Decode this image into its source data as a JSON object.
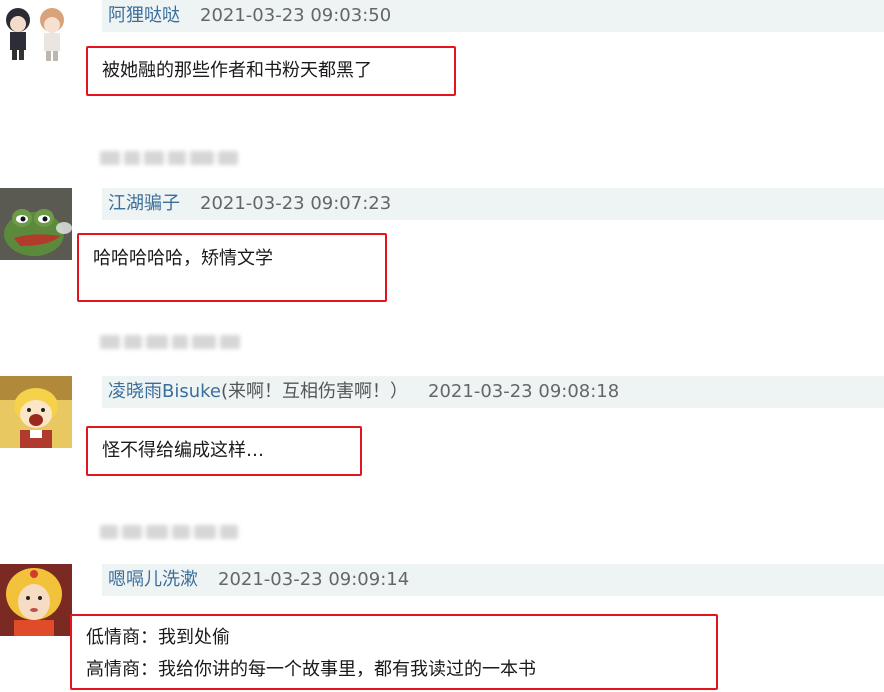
{
  "comments": [
    {
      "username": "阿狸哒哒",
      "suffix": "",
      "time": "2021-03-23 09:03:50",
      "lines": [
        "被她融的那些作者和书粉天都黑了"
      ],
      "avatar_icon": "two-boys-chibi-avatar"
    },
    {
      "username": "江湖骗子",
      "suffix": "",
      "time": "2021-03-23 09:07:23",
      "lines": [
        "哈哈哈哈哈，矫情文学"
      ],
      "avatar_icon": "pepe-frog-avatar"
    },
    {
      "username": "凌晓雨Bisuke",
      "suffix": "(来啊！互相伤害啊！）",
      "time": "2021-03-23 09:08:18",
      "lines": [
        "怪不得给编成这样…"
      ],
      "avatar_icon": "shouting-cartoon-avatar"
    },
    {
      "username": "嗯嗝儿洗漱",
      "suffix": "",
      "time": "2021-03-23 09:09:14",
      "lines": [
        "低情商：我到处偷",
        "高情商：我给你讲的每一个故事里，都有我读过的一本书"
      ],
      "avatar_icon": "blonde-girl-avatar"
    }
  ],
  "colors": {
    "highlight_border": "#e3141e",
    "header_bg": "#eef4f4",
    "username": "#3c6e9a"
  }
}
